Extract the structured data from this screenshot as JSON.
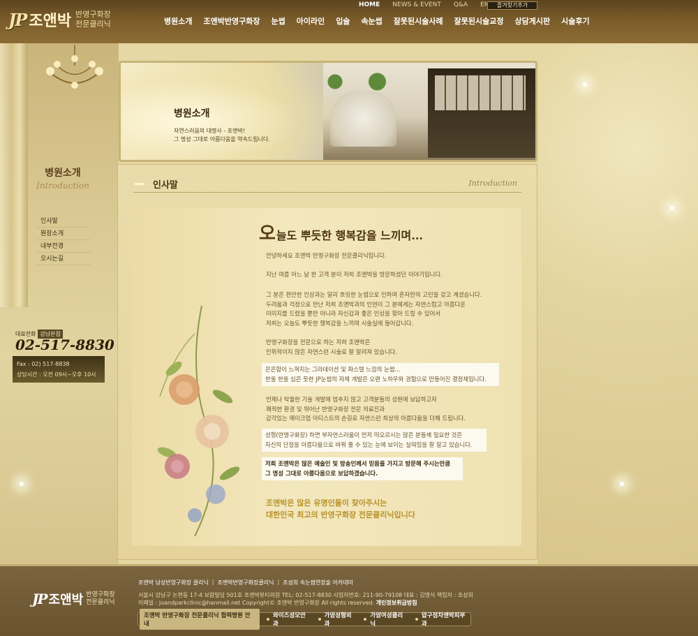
{
  "header": {
    "logo_mark": "JP",
    "logo_name": "조앤박",
    "logo_sub_1": "반영구화장",
    "logo_sub_2": "전문클리닉",
    "top_links": [
      "HOME",
      "NEWS & EVENT",
      "Q&A",
      "EMAIL"
    ],
    "bookmark": "즐겨찾기추가",
    "main_nav": [
      "병원소개",
      "조앤박반영구화장",
      "눈썹",
      "아이라인",
      "입술",
      "속눈썹",
      "잘못된시술사례",
      "잘못된시술교정",
      "상담게시판",
      "시술후기"
    ]
  },
  "hero": {
    "title": "병원소개",
    "line1": "자연스러움의 대명사 - 조앤박!",
    "line2": "그 명성 그대로 아름다움을 약속드립니다."
  },
  "sidebar": {
    "title": "병원소개",
    "title_en": "Introduction",
    "items": [
      {
        "label": "인사말"
      },
      {
        "label": "원장소개"
      },
      {
        "label": "내부전경"
      },
      {
        "label": "오시는길"
      }
    ],
    "phone_label": "대표전화",
    "branch": "강남본점",
    "phone": "02-517-8830",
    "fax": "Fax : 02) 517-8838",
    "hours": "상담시간 : 오전 09시~오후 10시"
  },
  "content": {
    "section_title": "인사말",
    "section_title_en": "Introduction",
    "headline_big": "오",
    "headline_rest": "늘도 뿌듯한 행복감을 느끼며...",
    "p1": [
      "안녕하세요  조앤박 반영구화장 전문클리닉입니다."
    ],
    "p2": [
      "지난 여름 어느 날 한 고객 분이 저희 조앤박을 방문하셨던 이야기입니다."
    ],
    "p3": [
      "그 분은 편안한 인상과는 달리 흐릿한 눈썹으로 인하여 혼자만의 고민을 갖고 계셨습니다.",
      "두려움과 걱정으로 만난 저희 조앤박과의 인연이 그 분에게는 자연스럽고 아름다운",
      "이미지를 드렸을 뿐만 아니라 자신감과 좋은 인상을 찾아 드릴 수 있어서",
      "저희는 오늘도 뿌듯한 행복감을 느끼며 시술실에 들어갑니다."
    ],
    "p4": [
      "반영구화장을 전문으로 하는 저희 조앤박은",
      "인위적이지 않은 자연스런 시술로 잘 알려져 있습니다."
    ],
    "hl1": [
      "은은함이 느껴지는 그라데이션 및 파스텔 느낌의 눈썹...",
      "한올 한올 심은 듯한 JP눈썹의 자체 개발은 오랜 노하우와 경험으로 만들어진 결정체입니다."
    ],
    "p5": [
      "언제나 탁월한 기술 개발에 멈추지 않고 고객분들의 성원에 보답하고자",
      "쾌적한 환경 및 뛰어난 반영구화장 전문 의료진과",
      "감각있는 메이크업 아티스트의 손길로 자연스런 최상의 아름다움을 더해 드립니다."
    ],
    "hl2": [
      "성형(반영구화장) 하면 부자연스러움이 먼저 떠오르시는 많은 분들께 필요한 것은",
      "자신의 단점을 아름다움으로 바꿔 줄 수 있는 눈에 보이는 실력임을 잘 알고 있습니다."
    ],
    "hl3": [
      "저희 조앤박은  많은 예술인 및 방송인께서 믿음을 가지고 방문해 주시는만큼",
      "그 명성 그대로 아름다움으로 보답하겠습니다."
    ],
    "closing": [
      "조앤박은 많은 유명인들이 찾아주시는",
      "대한민국 최고의 반영구화장 전문클리닉입니다"
    ]
  },
  "footer": {
    "logo_mark": "JP",
    "logo_name": "조앤박",
    "logo_sub_1": "반영구화장",
    "logo_sub_2": "전문클리닉",
    "links": [
      "조앤박 남성반영구화장 클리닉",
      "조앤박반영구화장클리닉",
      "조성희 속눈썹연장술 아카데미"
    ],
    "address_line1": "서울시 강남구 논현동 17-4 보람빌딩 501호 조앤박뷰티의원 TEL: 02-517-8830  사업자번호: 211-90-79108  대표 : 김명식   책임자 : 조성희",
    "address_line2": "이메일 : joandparkclinic@hanmail.net   Copyright© 조앤박 반영구화장 All rights reserved.",
    "privacy": "개인정보취급방침",
    "partner_label": "조앤박 반영구화장 전문클리닉 협력병원 안내",
    "partners": [
      "와이즈성모안과",
      "가암성형외과",
      "가암여성클리닉",
      "압구정차앤박피부과"
    ]
  }
}
